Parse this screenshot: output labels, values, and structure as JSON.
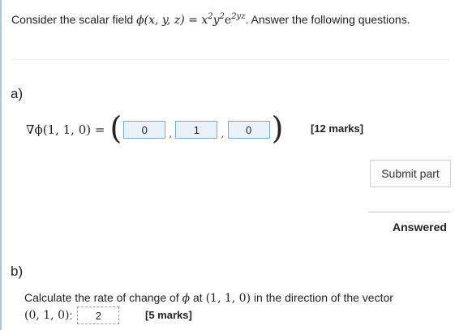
{
  "intro": {
    "prefix": "Consider the scalar field ",
    "field_lhs": "ϕ(x, y, z) = ",
    "field_x": "x",
    "exp_2a": "2",
    "field_y": "y",
    "exp_2b": "2",
    "field_e": "e",
    "exp_2yz": "2yz",
    "suffix": ". Answer the following questions."
  },
  "part_a": {
    "label": "a)",
    "formula_lhs": "∇ϕ(1, 1, 0) =",
    "open_paren": "(",
    "close_paren": ")",
    "answers": [
      "0",
      "1",
      "0"
    ],
    "separator": ",",
    "marks": "[12 marks]",
    "submit_label": "Submit part",
    "status": "Answered"
  },
  "part_b": {
    "label": "b)",
    "question_pre": "Calculate the rate of change of ",
    "question_phi": "ϕ",
    "question_mid": " at ",
    "question_point": "(1, 1, 0)",
    "question_post": " in the direction of the vector",
    "vector": "(0, 1, 0)",
    "colon": ":",
    "answer": "2",
    "marks": "[5 marks]"
  }
}
